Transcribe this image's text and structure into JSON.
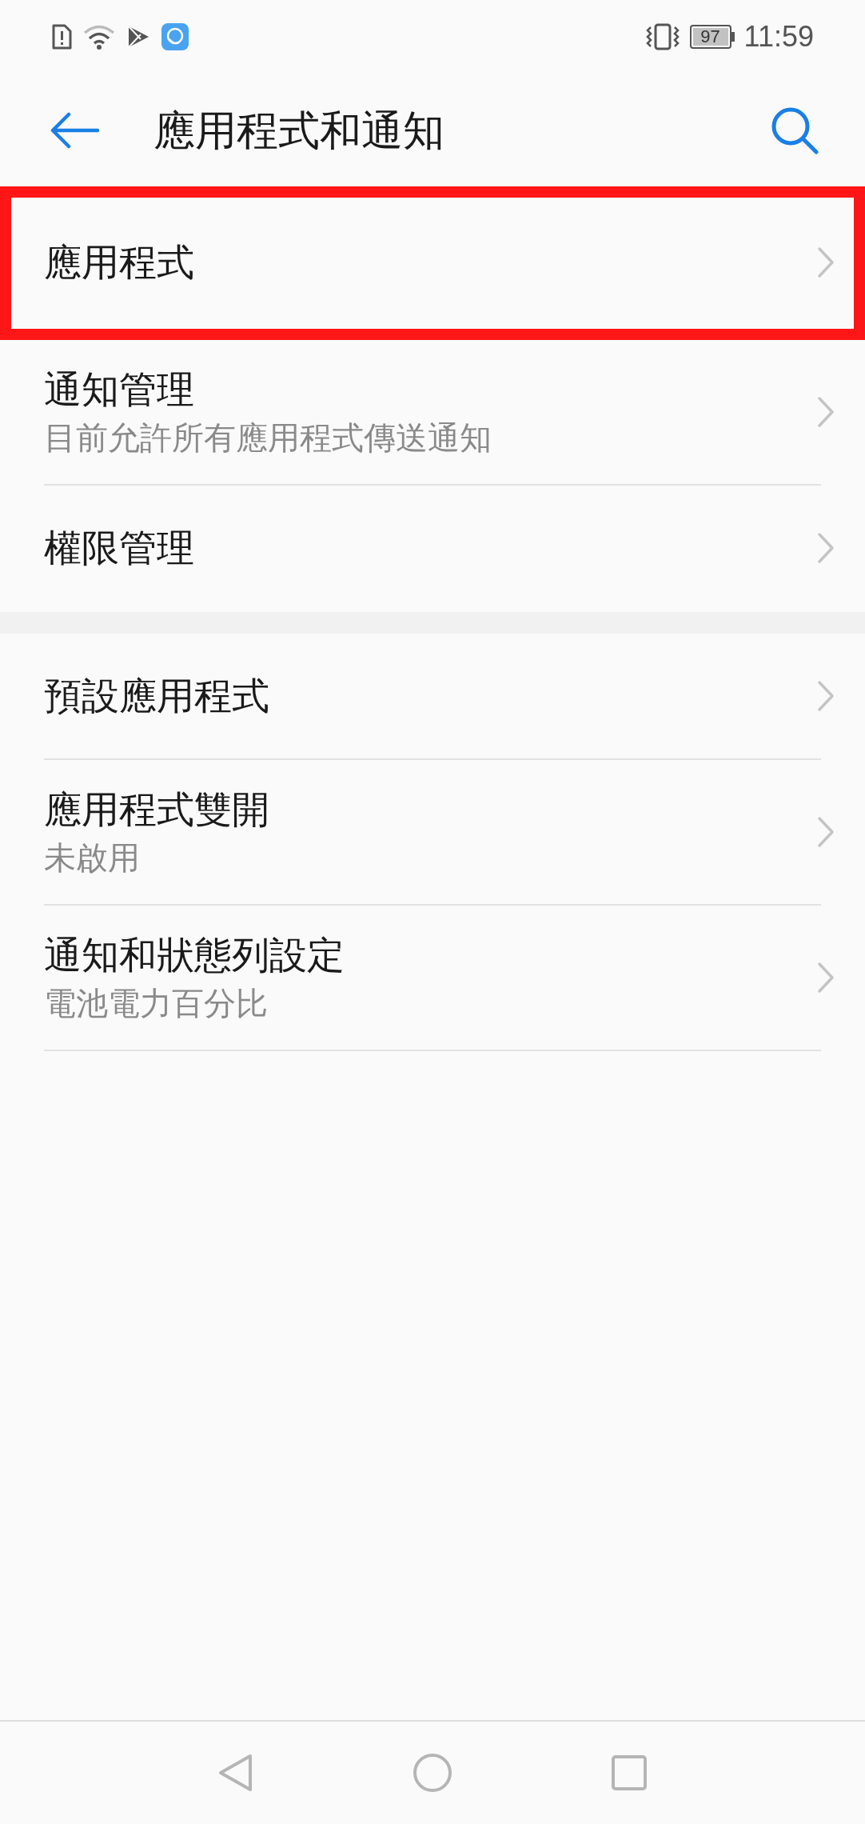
{
  "status_bar": {
    "battery": "97",
    "time": "11:59"
  },
  "header": {
    "title": "應用程式和通知"
  },
  "groups": [
    {
      "items": [
        {
          "title": "應用程式",
          "highlighted": true,
          "divider": false
        },
        {
          "title": "通知管理",
          "subtitle": "目前允許所有應用程式傳送通知",
          "highlighted": false,
          "divider": true
        },
        {
          "title": "權限管理",
          "highlighted": false,
          "divider": false
        }
      ]
    },
    {
      "items": [
        {
          "title": "預設應用程式",
          "highlighted": false,
          "divider": true
        },
        {
          "title": "應用程式雙開",
          "subtitle": "未啟用",
          "highlighted": false,
          "divider": true
        },
        {
          "title": "通知和狀態列設定",
          "subtitle": "電池電力百分比",
          "highlighted": false,
          "divider": true
        }
      ]
    }
  ]
}
